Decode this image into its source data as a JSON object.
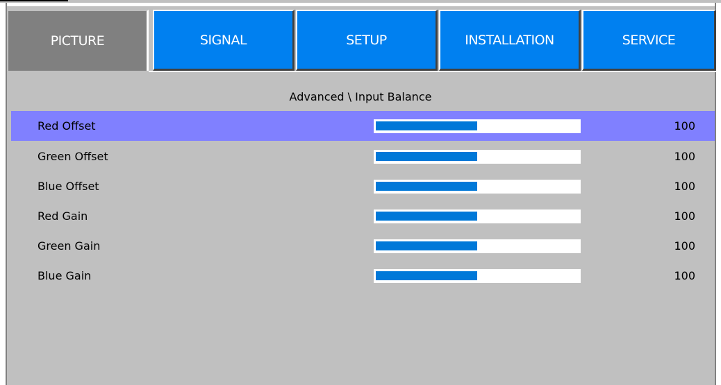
{
  "tabs": [
    {
      "label": "PICTURE",
      "active": true
    },
    {
      "label": "SIGNAL",
      "active": false
    },
    {
      "label": "SETUP",
      "active": false
    },
    {
      "label": "INSTALLATION",
      "active": false
    },
    {
      "label": "SERVICE",
      "active": false
    }
  ],
  "breadcrumb": "Advanced \\ Input Balance",
  "settings": [
    {
      "label": "Red Offset",
      "value": "100",
      "fraction": 0.5,
      "selected": true
    },
    {
      "label": "Green Offset",
      "value": "100",
      "fraction": 0.5,
      "selected": false
    },
    {
      "label": "Blue Offset",
      "value": "100",
      "fraction": 0.5,
      "selected": false
    },
    {
      "label": "Red Gain",
      "value": "100",
      "fraction": 0.5,
      "selected": false
    },
    {
      "label": "Green Gain",
      "value": "100",
      "fraction": 0.5,
      "selected": false
    },
    {
      "label": "Blue Gain",
      "value": "100",
      "fraction": 0.5,
      "selected": false
    }
  ],
  "colors": {
    "tab_active": "#808080",
    "tab_inactive": "#0080f0",
    "selected_row": "#8080ff",
    "slider_fill": "#0078d8",
    "background": "#c0c0c0"
  }
}
